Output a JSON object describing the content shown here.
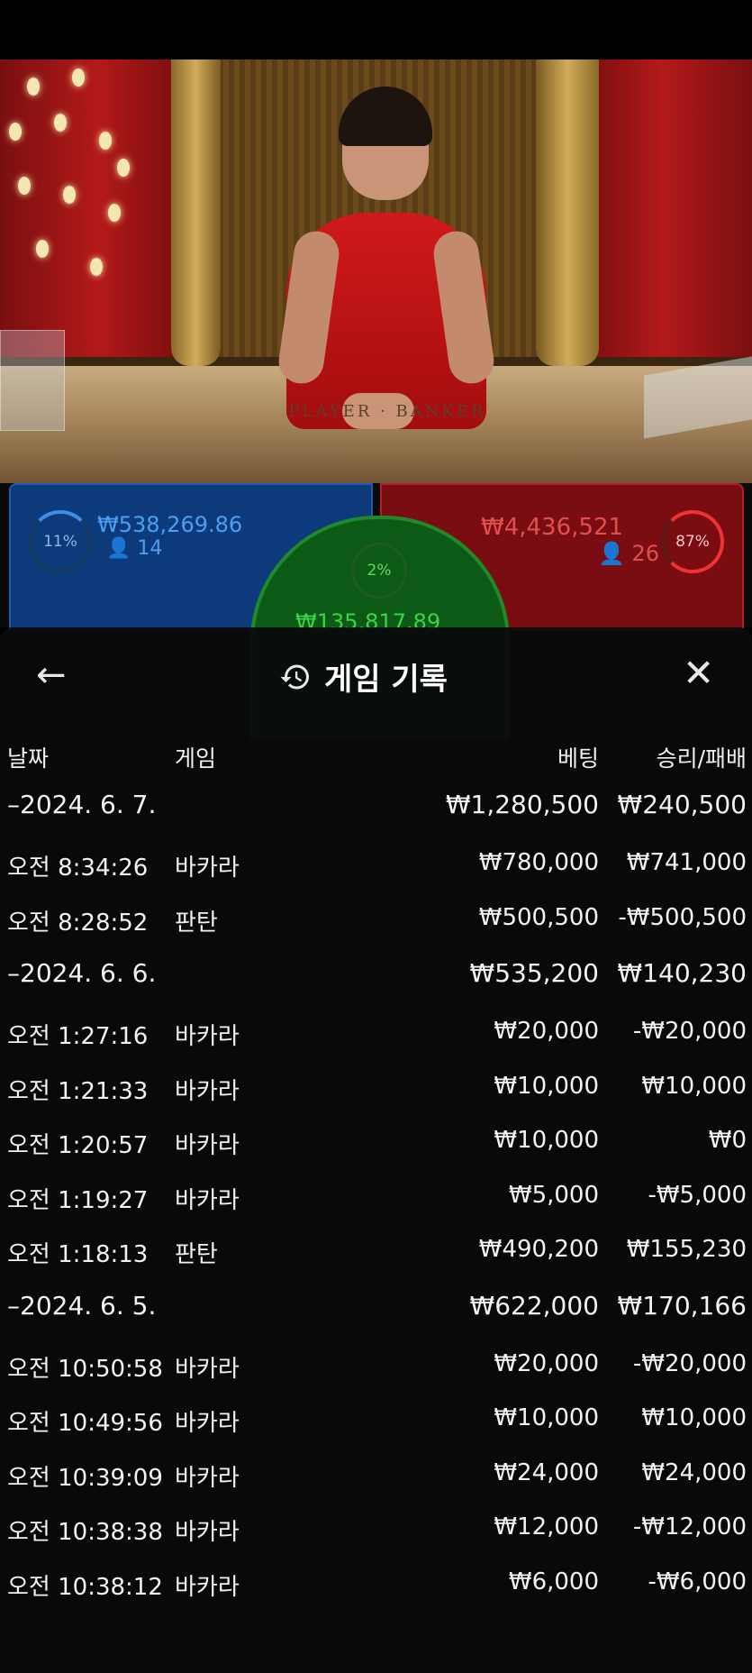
{
  "video": {
    "table_text": "PLAYER  ·  BANKER"
  },
  "bets": {
    "player": {
      "percent": "11%",
      "amount": "₩538,269.86",
      "count": "14",
      "color": "#0d3a7a"
    },
    "tie": {
      "percent": "2%",
      "amount": "₩135,817.89",
      "color": "#0c5a16"
    },
    "banker": {
      "percent": "87%",
      "amount": "₩4,436,521",
      "count": "26",
      "color": "#7a0d12"
    }
  },
  "modal": {
    "title": "게임 기록",
    "back_icon": "back-arrow-icon",
    "close_icon": "close-icon",
    "history_icon": "history-icon"
  },
  "columns": {
    "date": "날짜",
    "game": "게임",
    "bet": "베팅",
    "result": "승리/패배"
  },
  "rows": [
    {
      "type": "group",
      "date": "–2024. 6. 7.",
      "game": "",
      "bet": "₩1,280,500",
      "result": "₩240,500"
    },
    {
      "type": "item",
      "date": "오전 8:34:26",
      "game": "바카라",
      "bet": "₩780,000",
      "result": "₩741,000"
    },
    {
      "type": "item",
      "date": "오전 8:28:52",
      "game": "판탄",
      "bet": "₩500,500",
      "result": "-₩500,500"
    },
    {
      "type": "group",
      "date": "–2024. 6. 6.",
      "game": "",
      "bet": "₩535,200",
      "result": "₩140,230"
    },
    {
      "type": "item",
      "date": "오전 1:27:16",
      "game": "바카라",
      "bet": "₩20,000",
      "result": "-₩20,000"
    },
    {
      "type": "item",
      "date": "오전 1:21:33",
      "game": "바카라",
      "bet": "₩10,000",
      "result": "₩10,000"
    },
    {
      "type": "item",
      "date": "오전 1:20:57",
      "game": "바카라",
      "bet": "₩10,000",
      "result": "₩0"
    },
    {
      "type": "item",
      "date": "오전 1:19:27",
      "game": "바카라",
      "bet": "₩5,000",
      "result": "-₩5,000"
    },
    {
      "type": "item",
      "date": "오전 1:18:13",
      "game": "판탄",
      "bet": "₩490,200",
      "result": "₩155,230"
    },
    {
      "type": "group",
      "date": "–2024. 6. 5.",
      "game": "",
      "bet": "₩622,000",
      "result": "₩170,166"
    },
    {
      "type": "item",
      "date": "오전 10:50:58",
      "game": "바카라",
      "bet": "₩20,000",
      "result": "-₩20,000"
    },
    {
      "type": "item",
      "date": "오전 10:49:56",
      "game": "바카라",
      "bet": "₩10,000",
      "result": "₩10,000"
    },
    {
      "type": "item",
      "date": "오전 10:39:09",
      "game": "바카라",
      "bet": "₩24,000",
      "result": "₩24,000"
    },
    {
      "type": "item",
      "date": "오전 10:38:38",
      "game": "바카라",
      "bet": "₩12,000",
      "result": "-₩12,000"
    },
    {
      "type": "item",
      "date": "오전 10:38:12",
      "game": "바카라",
      "bet": "₩6,000",
      "result": "-₩6,000"
    }
  ]
}
